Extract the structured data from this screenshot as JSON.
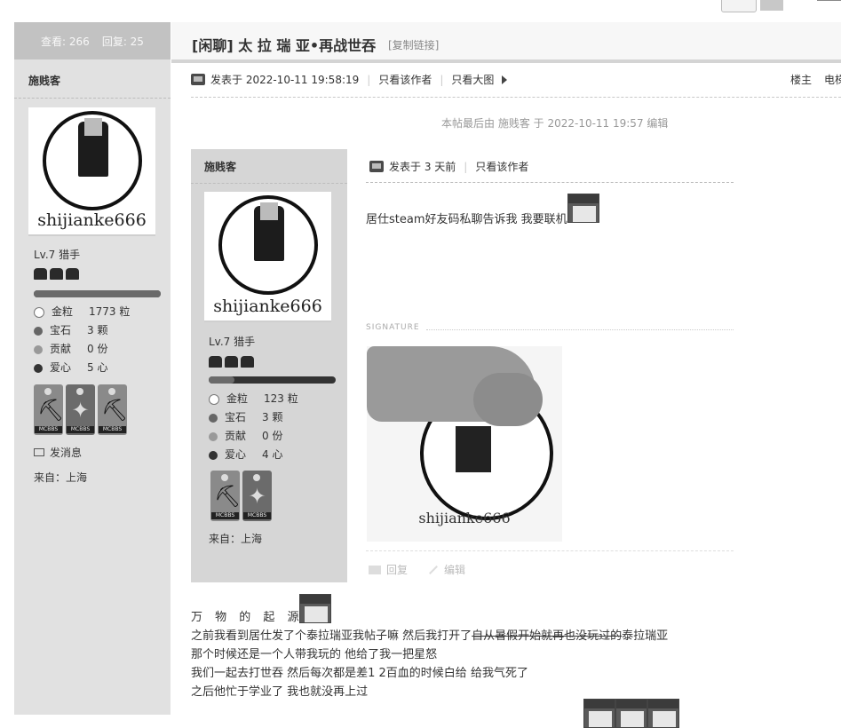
{
  "thread": {
    "views_label": "查看: 266",
    "replies_label": "回复: 25",
    "title": "[闲聊] 太 拉 瑞 亚•再战世吞",
    "copy_link": "[复制链接]"
  },
  "post_header": {
    "posted_at": "发表于 2022-10-11 19:58:19",
    "only_author": "只看该作者",
    "big_image": "只看大图",
    "floor": "楼主",
    "extra": "电梯"
  },
  "edit_note": "本帖最后由 施贱客 于 2022-10-11 19:57 编辑",
  "author": {
    "name": "施贱客",
    "avatar_name": "shijianke666",
    "level": "Lv.7 猎手",
    "xp_fraction": 1.0,
    "stats": [
      {
        "label": "金粒",
        "value": "1773 粒"
      },
      {
        "label": "宝石",
        "value": "3 颗"
      },
      {
        "label": "贡献",
        "value": "0 份"
      },
      {
        "label": "爱心",
        "value": "5 心"
      }
    ],
    "medal_tag": "MCBBS",
    "send_message": "发消息",
    "from": "来自：上海"
  },
  "quote": {
    "author": {
      "name": "施贱客",
      "avatar_name": "shijianke666",
      "level": "Lv.7 猎手",
      "xp_fraction": 0.2,
      "stats": [
        {
          "label": "金粒",
          "value": "123 粒"
        },
        {
          "label": "宝石",
          "value": "3 颗"
        },
        {
          "label": "贡献",
          "value": "0 份"
        },
        {
          "label": "爱心",
          "value": "4 心"
        }
      ],
      "medal_tag": "MCBBS",
      "from": "来自：上海"
    },
    "posted_at": "发表于 3 天前",
    "only_author": "只看该作者",
    "body": "居仕steam好友码私聊告诉我 我要联机",
    "signature_label": "SIGNATURE",
    "signature_name": "shijianke666",
    "reply": "回复",
    "edit": "编辑"
  },
  "content": {
    "line0": "万 物 的 起 源",
    "line1_a": "之前我看到居仕发了个泰拉瑞亚我帖子嘛 然后我打开了",
    "line1_strike": "自从暑假开始就再也没玩过的",
    "line1_b": "泰拉瑞亚",
    "line2": "那个时候还是一个人带我玩的 他给了我一把星怒",
    "line3": "我们一起去打世吞 然后每次都是差1 2百血的时候白给 给我气死了",
    "line4": "之后他忙于学业了 我也就没再上过"
  }
}
